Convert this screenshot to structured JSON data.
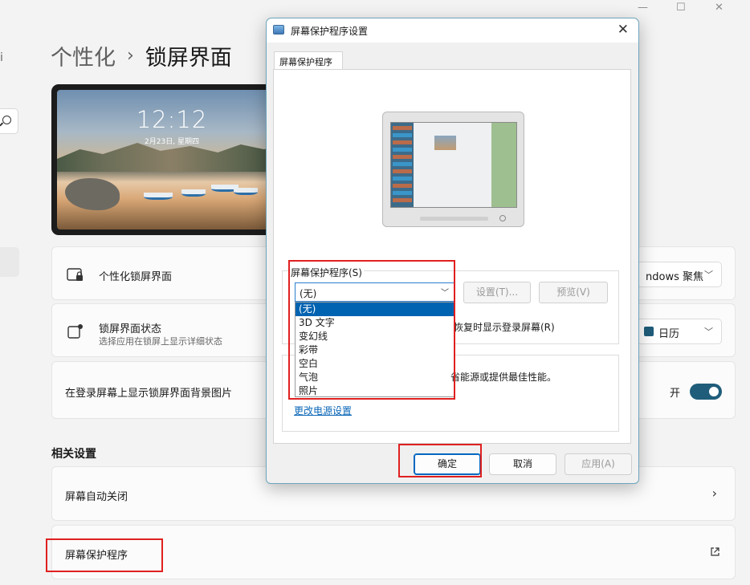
{
  "window": {
    "minimize_glyph": "—",
    "maximize_glyph": "☐",
    "close_glyph": "✕"
  },
  "nav": {
    "bump_glyph": "i"
  },
  "breadcrumb": {
    "parent": "个性化",
    "separator": "›",
    "current": "锁屏界面"
  },
  "lockscreen_preview": {
    "time": "12:12",
    "date": "2月23日, 星期四"
  },
  "cards": {
    "personalize": {
      "title": "个性化锁屏界面",
      "value": "ndows 聚焦"
    },
    "status": {
      "title": "锁屏界面状态",
      "subtitle": "选择应用在锁屏上显示详细状态",
      "value": "日历"
    },
    "show_bg": {
      "title": "在登录屏幕上显示锁屏界面背景图片",
      "toggle_label": "开",
      "toggle_on": true
    }
  },
  "related": {
    "section_title": "相关设置",
    "screen_off": "屏幕自动关闭",
    "screensaver": "屏幕保护程序"
  },
  "dialog": {
    "title": "屏幕保护程序设置",
    "tab": "屏幕保护程序",
    "group_label": "屏幕保护程序(S)",
    "selected_value": "(无)",
    "options": [
      "(无)",
      "3D 文字",
      "变幻线",
      "彩带",
      "空白",
      "气泡",
      "照片"
    ],
    "settings_button": "设置(T)...",
    "preview_button": "预览(V)",
    "resume_label": "恢复时显示登录屏幕(R)",
    "power_text": "省能源或提供最佳性能。",
    "power_link": "更改电源设置",
    "ok": "确定",
    "cancel": "取消",
    "apply": "应用(A)"
  },
  "colors": {
    "accent": "#1f5d7a",
    "highlight": "#e02020",
    "selection": "#0063b1"
  }
}
